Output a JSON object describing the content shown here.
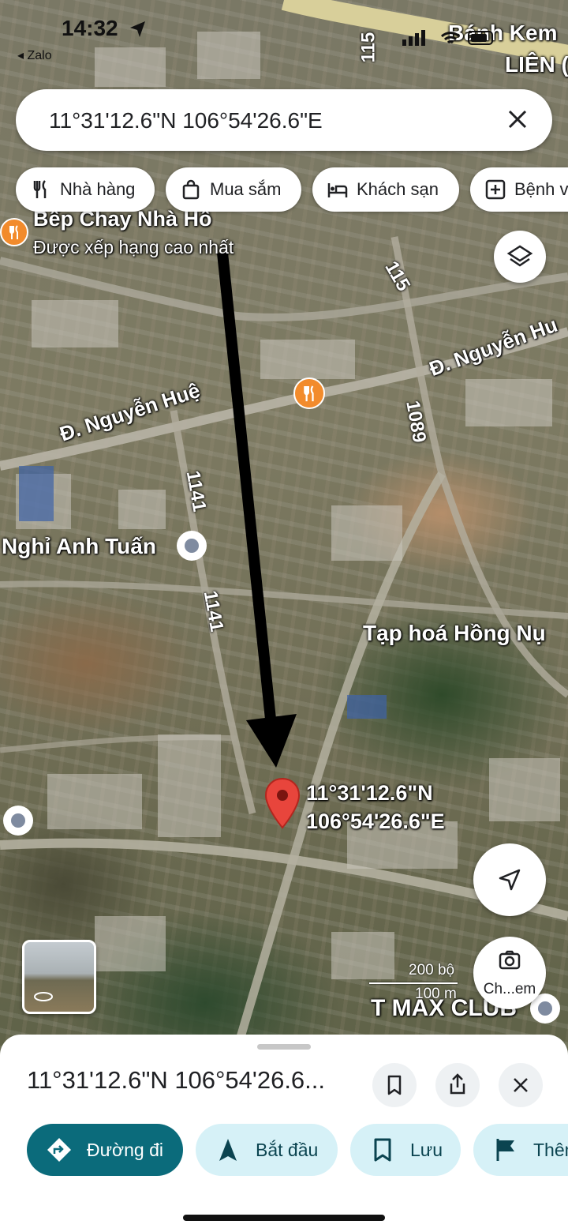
{
  "status_bar": {
    "time": "14:32",
    "back_app": "Zalo",
    "back_arrow": "◂"
  },
  "search": {
    "query": "11°31'12.6\"N 106°54'26.6\"E"
  },
  "chips": [
    {
      "label": "Nhà hàng",
      "icon": "restaurant-icon"
    },
    {
      "label": "Mua sắm",
      "icon": "shopping-bag-icon"
    },
    {
      "label": "Khách sạn",
      "icon": "hotel-bed-icon"
    },
    {
      "label": "Bệnh v",
      "icon": "hospital-icon"
    }
  ],
  "map": {
    "place_labels": {
      "bep_chay": "Bếp Chay Nhà Hồ",
      "bep_chay_sub": "Được xếp hạng cao nhất",
      "nghi_anh_tuan": "Nghỉ Anh Tuấn",
      "tap_hoa": "Tạp hoá Hồng Nụ",
      "banh_kem": "Bánh Kem",
      "lien": "LIÊN (",
      "tmax": "T MAX CLUB"
    },
    "street_labels": {
      "nguyen_hue_left": "Đ. Nguyễn Huệ",
      "nguyen_hue_right": "Đ. Nguyễn Hu"
    },
    "road_numbers": {
      "r115_top": "115",
      "r115_mid": "115",
      "r1089": "1089",
      "r1141_a": "1141",
      "r1141_b": "1141"
    },
    "pin": {
      "lat": "11°31'12.6\"N",
      "lng": "106°54'26.6\"E"
    },
    "scale": {
      "imperial": "200 bộ",
      "metric": "100 m"
    },
    "street_view_label": "Ch...em",
    "accent_red": "#e8453c",
    "poi_orange": "#f28b2c"
  },
  "sheet": {
    "title": "11°31'12.6\"N 106°54'26.6...",
    "actions": [
      {
        "label": "Đường đi",
        "icon": "directions-icon"
      },
      {
        "label": "Bắt đầu",
        "icon": "navigation-arrow-icon"
      },
      {
        "label": "Lưu",
        "icon": "bookmark-icon"
      },
      {
        "label": "Thêm",
        "icon": "flag-icon"
      }
    ],
    "primary_color": "#0b6b7b",
    "secondary_color": "#d6f1f7"
  }
}
